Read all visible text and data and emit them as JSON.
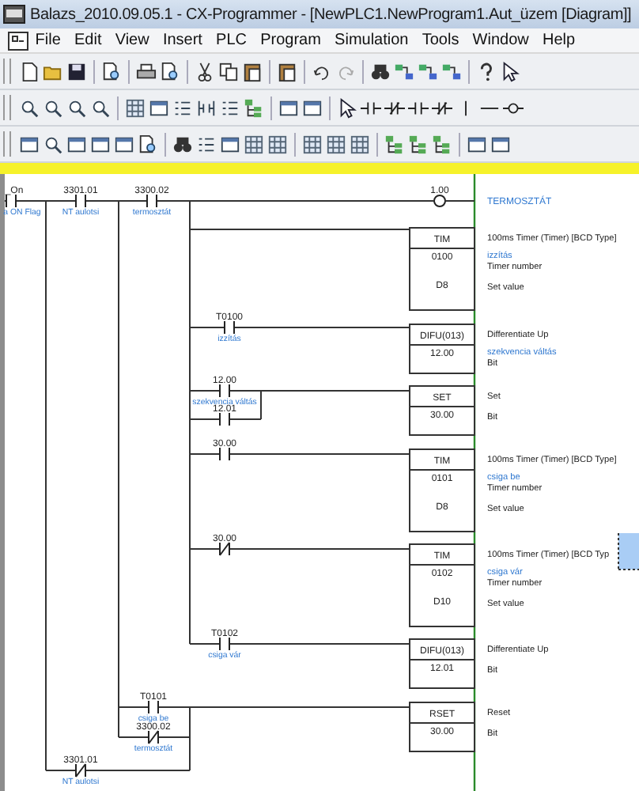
{
  "window": {
    "title": "Balazs_2010.09.05.1 - CX-Programmer - [NewPLC1.NewProgram1.Aut_üzem [Diagram]]"
  },
  "menu": [
    "File",
    "Edit",
    "View",
    "Insert",
    "PLC",
    "Program",
    "Simulation",
    "Tools",
    "Window",
    "Help"
  ],
  "diagram": {
    "contacts": [
      {
        "kind": "no",
        "address": "_On",
        "comment": "a ON Flag"
      },
      {
        "kind": "no",
        "address": "3301.01",
        "comment": "NT aulotsi"
      },
      {
        "kind": "no",
        "address": "3300.02",
        "comment": "termosztát"
      },
      {
        "kind": "no",
        "address": "T0100",
        "comment": "izzítás"
      },
      {
        "kind": "no",
        "address": "12.00",
        "comment": "szekvencia váltás"
      },
      {
        "kind": "no",
        "address": "12.01"
      },
      {
        "kind": "no",
        "address": "30.00"
      },
      {
        "kind": "nc",
        "address": "30.00"
      },
      {
        "kind": "no",
        "address": "T0102",
        "comment": "csiga vár"
      },
      {
        "kind": "no",
        "address": "T0101",
        "comment": "csiga be"
      },
      {
        "kind": "nc",
        "address": "3300.02",
        "comment": "termosztát"
      },
      {
        "kind": "nc",
        "address": "3301.01",
        "comment": "NT aulotsi"
      }
    ],
    "coil": {
      "address": "1.00",
      "comment": "TERMOSZTÁT"
    },
    "blocks": [
      {
        "mnemonic": "TIM",
        "description": "100ms Timer (Timer) [BCD Type]",
        "operands": [
          {
            "value": "0100",
            "comment": "izzítás",
            "label": "Timer number"
          },
          {
            "value": "D8",
            "label": "Set value"
          }
        ]
      },
      {
        "mnemonic": "DIFU(013)",
        "description": "Differentiate Up",
        "operands": [
          {
            "value": "12.00",
            "comment": "szekvencia váltás",
            "label": "Bit"
          }
        ]
      },
      {
        "mnemonic": "SET",
        "description": "Set",
        "operands": [
          {
            "value": "30.00",
            "label": "Bit"
          }
        ]
      },
      {
        "mnemonic": "TIM",
        "description": "100ms Timer (Timer) [BCD Type]",
        "operands": [
          {
            "value": "0101",
            "comment": "csiga be",
            "label": "Timer number"
          },
          {
            "value": "D8",
            "label": "Set value"
          }
        ]
      },
      {
        "mnemonic": "TIM",
        "description": "100ms Timer (Timer) [BCD Typ",
        "operands": [
          {
            "value": "0102",
            "comment": "csiga vár",
            "label": "Timer number"
          },
          {
            "value": "D10",
            "label": "Set value"
          }
        ]
      },
      {
        "mnemonic": "DIFU(013)",
        "description": "Differentiate Up",
        "operands": [
          {
            "value": "12.01",
            "label": "Bit"
          }
        ]
      },
      {
        "mnemonic": "RSET",
        "description": "Reset",
        "operands": [
          {
            "value": "30.00",
            "label": "Bit"
          }
        ]
      }
    ]
  }
}
